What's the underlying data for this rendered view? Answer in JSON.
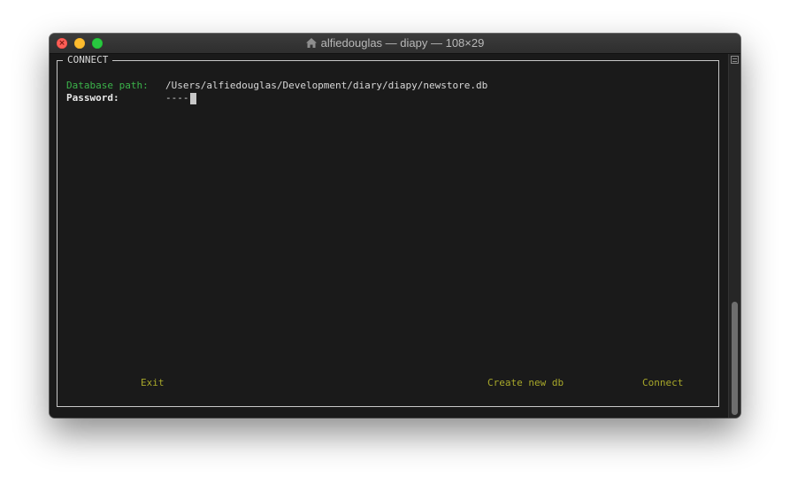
{
  "window": {
    "title": "alfiedouglas — diapy — 108×29",
    "title_icon": "home-icon"
  },
  "connect": {
    "frame_title": "CONNECT",
    "db_path_label": "Database path:",
    "db_path_value": "/Users/alfiedouglas/Development/diary/diapy/newstore.db",
    "password_label": "Password:",
    "password_value": "----"
  },
  "buttons": {
    "exit": "Exit",
    "create": "Create new db",
    "connect": "Connect"
  },
  "colors": {
    "label_green": "#3bb34a",
    "button_yellow": "#a8a82a",
    "background": "#1a1a1a"
  }
}
